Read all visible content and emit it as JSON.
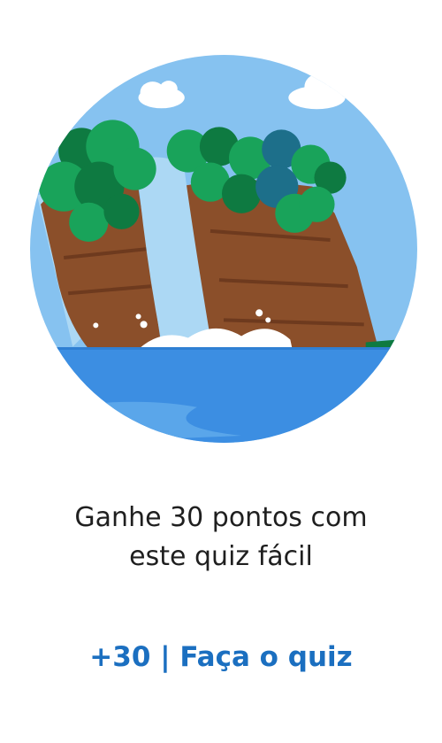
{
  "card": {
    "illustration_icon": "waterfall-illustration",
    "description_line1": "Ganhe 30 pontos com",
    "description_line2": "este quiz fácil",
    "cta_label": "+30 | Faça o quiz",
    "colors": {
      "cta": "#1b6fc0",
      "text": "#1f1f1f",
      "sky": "#86c2f0",
      "water": "#3c8ee2",
      "cliff": "#8b4f2a",
      "foliage": "#19a35a",
      "falls": "#acd8f4"
    }
  }
}
